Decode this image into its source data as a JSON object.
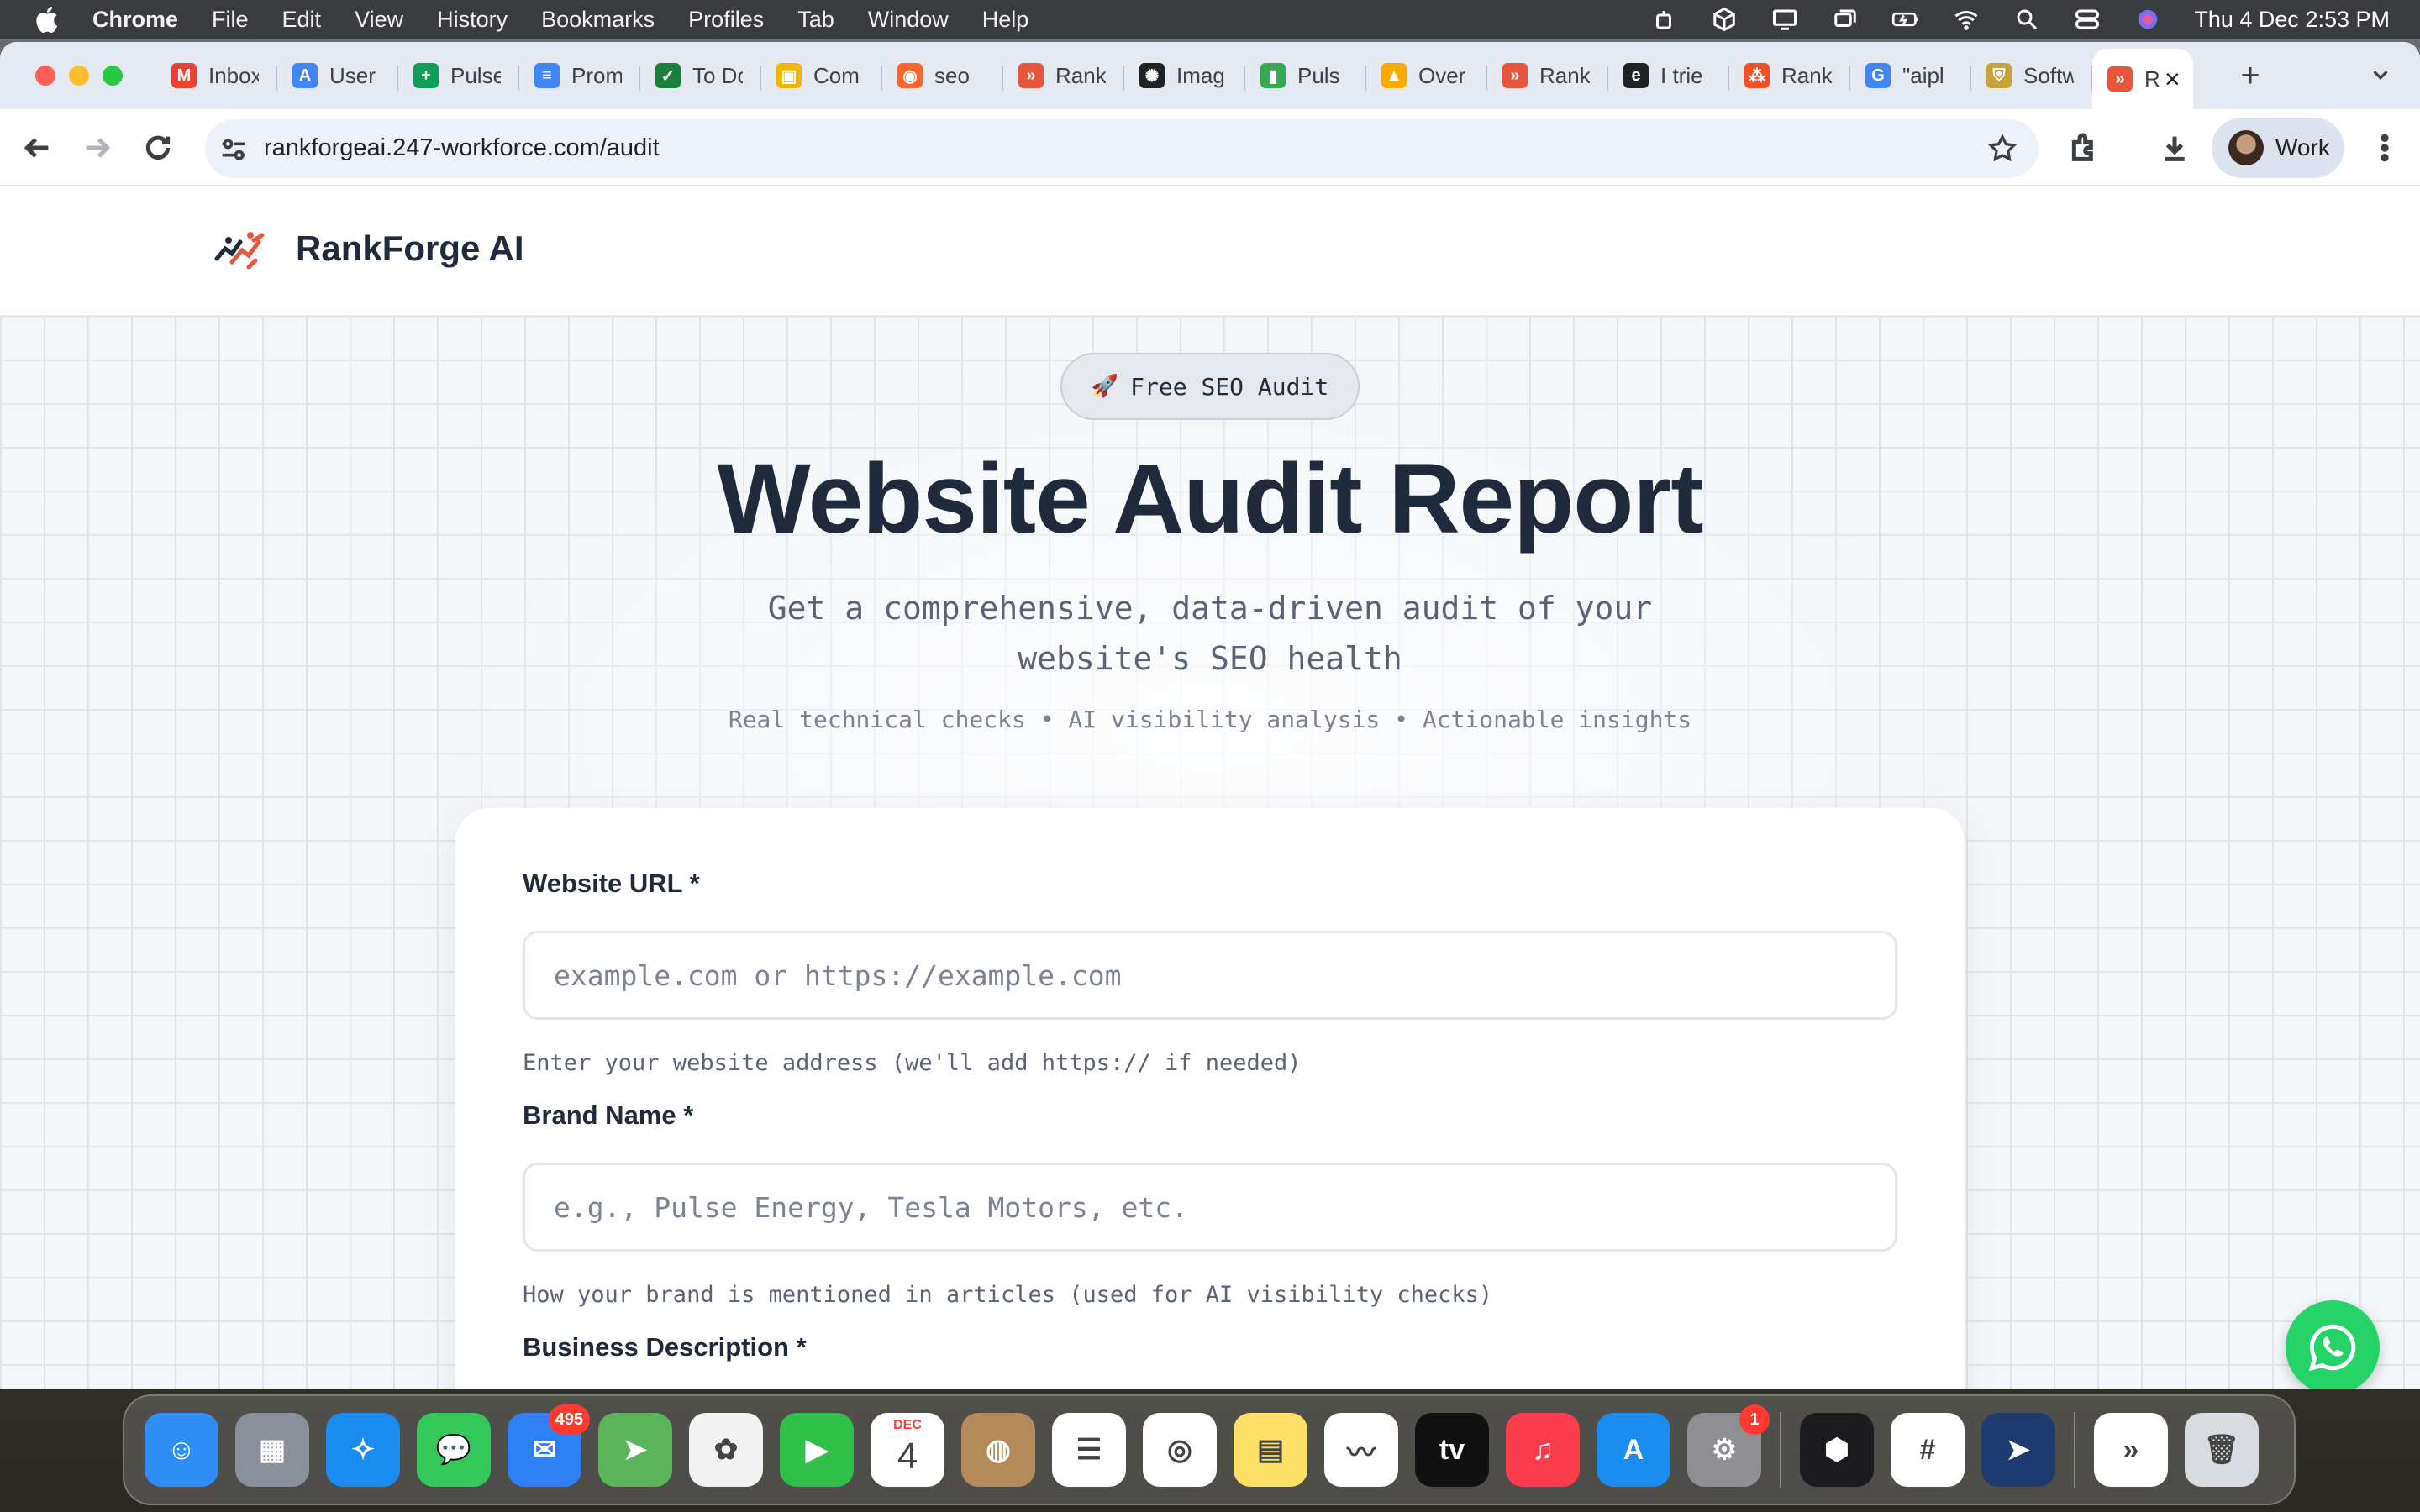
{
  "menubar": {
    "app": "Chrome",
    "items": [
      "File",
      "Edit",
      "View",
      "History",
      "Bookmarks",
      "Profiles",
      "Tab",
      "Window",
      "Help"
    ],
    "clock": "Thu 4 Dec  2:53 PM"
  },
  "tabs": [
    {
      "title": "Inbox",
      "icon": "gmail-icon",
      "color": "#ea4335",
      "glyph": "M"
    },
    {
      "title": "User",
      "icon": "google-ads-icon",
      "color": "#4285f4",
      "glyph": "A"
    },
    {
      "title": "Pulse",
      "icon": "sheets-icon",
      "color": "#0f9d58",
      "glyph": "+"
    },
    {
      "title": "Prom",
      "icon": "docs-icon",
      "color": "#4285f4",
      "glyph": "≡"
    },
    {
      "title": "To Do",
      "icon": "checklist-icon",
      "color": "#188038",
      "glyph": "✓"
    },
    {
      "title": "Com",
      "icon": "image-icon",
      "color": "#f4b400",
      "glyph": "▣"
    },
    {
      "title": "seo",
      "icon": "semrush-icon",
      "color": "#ff642d",
      "glyph": "◉"
    },
    {
      "title": "Rank",
      "icon": "rankforge-icon",
      "color": "#e8553d",
      "glyph": "»"
    },
    {
      "title": "Imag",
      "icon": "openai-icon",
      "color": "#202124",
      "glyph": "✺"
    },
    {
      "title": "Puls",
      "icon": "maps-icon",
      "color": "#34a853",
      "glyph": "▮"
    },
    {
      "title": "Over",
      "icon": "analytics-icon",
      "color": "#f9ab00",
      "glyph": "▲"
    },
    {
      "title": "Rank",
      "icon": "rankforge-icon",
      "color": "#e8553d",
      "glyph": "»"
    },
    {
      "title": "I trie",
      "icon": "e-icon",
      "color": "#202124",
      "glyph": "e"
    },
    {
      "title": "Rank",
      "icon": "bolt-icon",
      "color": "#f25022",
      "glyph": "⁂"
    },
    {
      "title": "\"aipl",
      "icon": "google-icon",
      "color": "#4285f4",
      "glyph": "G"
    },
    {
      "title": "Softw",
      "icon": "shield-icon",
      "color": "#c8a23a",
      "glyph": "⛨"
    }
  ],
  "active_tab": {
    "title": "R",
    "icon": "rankforge-icon"
  },
  "address": {
    "url": "rankforgeai.247-workforce.com/audit"
  },
  "profile": {
    "name": "Work"
  },
  "site": {
    "brand": "RankForge AI",
    "pill": "Free SEO Audit",
    "pill_emoji": "🚀",
    "title": "Website Audit Report",
    "subtitle": "Get a comprehensive, data-driven audit of your website's SEO health",
    "tagline": "Real technical checks • AI visibility analysis • Actionable insights"
  },
  "form": {
    "url_label": "Website URL *",
    "url_placeholder": "example.com or https://example.com",
    "url_help": "Enter your website address (we'll add https:// if needed)",
    "brand_label": "Brand Name *",
    "brand_placeholder": "e.g., Pulse Energy, Tesla Motors, etc.",
    "brand_help": "How your brand is mentioned in articles (used for AI visibility checks)",
    "desc_label": "Business Description *"
  },
  "dock": {
    "apps": [
      {
        "name": "finder",
        "color": "#2f8ef5",
        "glyph": "☺"
      },
      {
        "name": "launchpad",
        "color": "#8a8f99",
        "glyph": "▦"
      },
      {
        "name": "safari",
        "color": "#1a8cf0",
        "glyph": "✧"
      },
      {
        "name": "messages",
        "color": "#34c759",
        "glyph": "💬"
      },
      {
        "name": "mail",
        "color": "#2f7ff5",
        "glyph": "✉",
        "badge": "495"
      },
      {
        "name": "maps",
        "color": "#5ab45a",
        "glyph": "➤"
      },
      {
        "name": "photos",
        "color": "#f2f2f2",
        "glyph": "✿"
      },
      {
        "name": "facetime",
        "color": "#30c04a",
        "glyph": "▶"
      },
      {
        "name": "calendar",
        "color": "#ffffff",
        "glyph": "4",
        "month": "DEC"
      },
      {
        "name": "contacts",
        "color": "#b48a5a",
        "glyph": "◍"
      },
      {
        "name": "reminders",
        "color": "#ffffff",
        "glyph": "☰"
      },
      {
        "name": "chrome",
        "color": "#ffffff",
        "glyph": "◎"
      },
      {
        "name": "notes",
        "color": "#ffe066",
        "glyph": "▤"
      },
      {
        "name": "freeform",
        "color": "#ffffff",
        "glyph": "〰"
      },
      {
        "name": "apple-tv",
        "color": "#111111",
        "glyph": "tv"
      },
      {
        "name": "music",
        "color": "#fa3c4c",
        "glyph": "♫"
      },
      {
        "name": "app-store",
        "color": "#1a8cf0",
        "glyph": "A"
      },
      {
        "name": "system-settings",
        "color": "#8e8e93",
        "glyph": "⚙",
        "badge": "1"
      }
    ],
    "apps_right": [
      {
        "name": "cube-app",
        "color": "#1c1c1e",
        "glyph": "⬢"
      },
      {
        "name": "slack",
        "color": "#ffffff",
        "glyph": "#"
      },
      {
        "name": "direct-mail",
        "color": "#1e3a6e",
        "glyph": "➤"
      }
    ],
    "apps_end": [
      {
        "name": "rankforge-doc",
        "color": "#ffffff",
        "glyph": "»"
      },
      {
        "name": "trash",
        "color": "#d8dbe0",
        "glyph": "🗑"
      }
    ]
  }
}
